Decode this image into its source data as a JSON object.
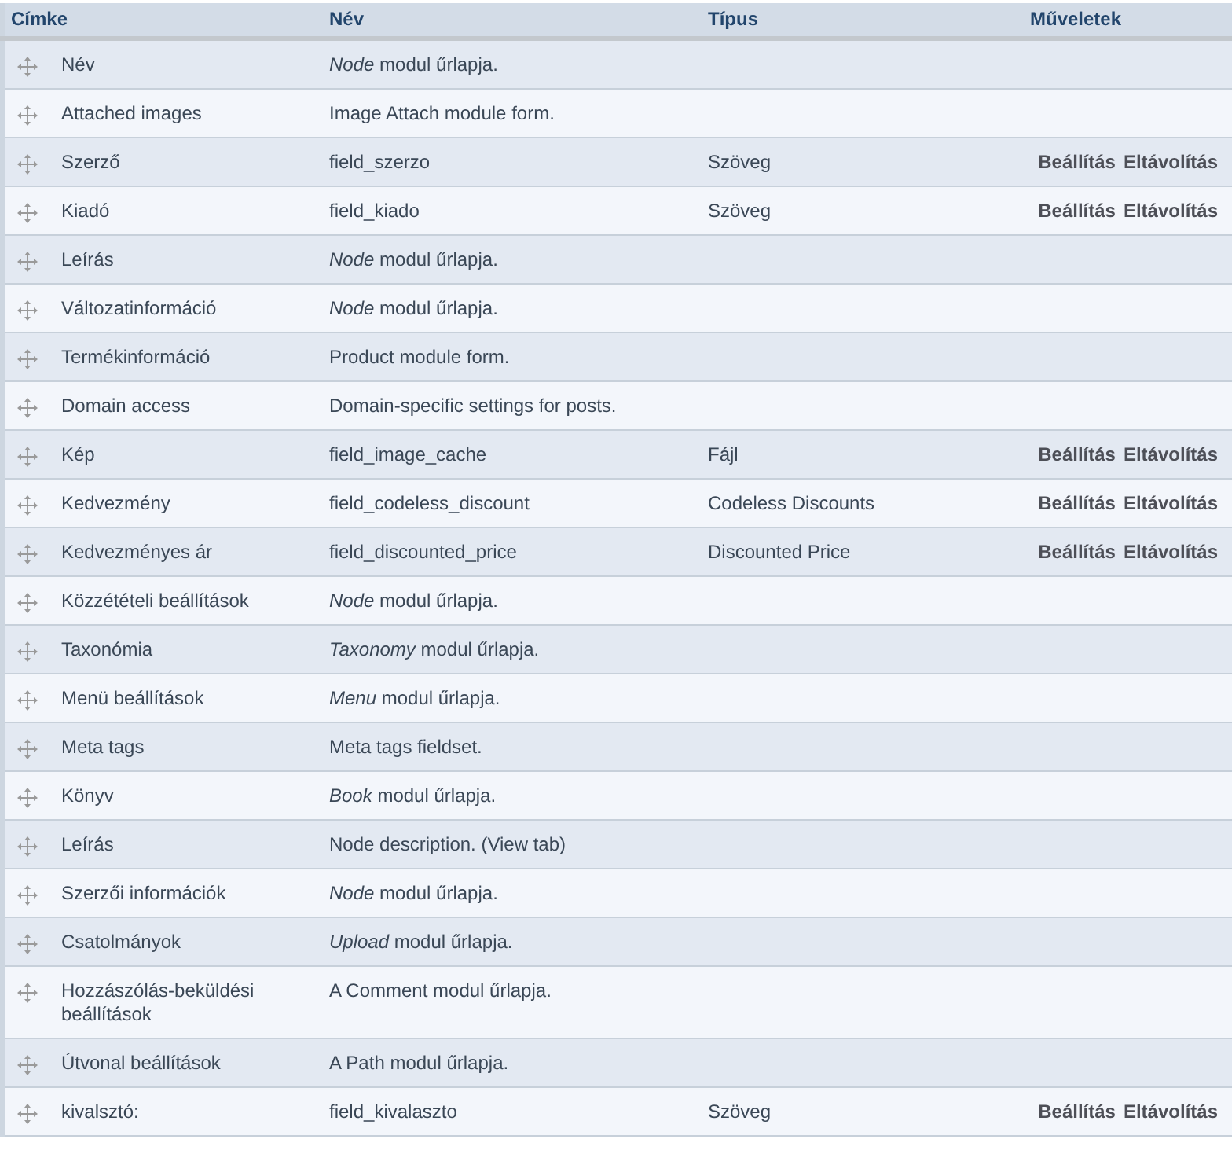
{
  "table": {
    "columns": [
      "Címke",
      "Név",
      "Típus",
      "Műveletek"
    ],
    "rows": [
      {
        "label": "Név",
        "name": "*Node* modul űrlapja."
      },
      {
        "label": "Attached images",
        "name": "Image Attach module form."
      },
      {
        "label": "Szerző",
        "name": "field_szerzo",
        "type": "Szöveg",
        "actions": [
          "Beállítás",
          "Eltávolítás"
        ]
      },
      {
        "label": "Kiadó",
        "name": "field_kiado",
        "type": "Szöveg",
        "actions": [
          "Beállítás",
          "Eltávolítás"
        ]
      },
      {
        "label": "Leírás",
        "name": "*Node* modul űrlapja."
      },
      {
        "label": "Változatinformáció",
        "name": "*Node* modul űrlapja."
      },
      {
        "label": "Termékinformáció",
        "name": "Product module form."
      },
      {
        "label": "Domain access",
        "name": "Domain-specific settings for posts."
      },
      {
        "label": "Kép",
        "name": "field_image_cache",
        "type": "Fájl",
        "actions": [
          "Beállítás",
          "Eltávolítás"
        ]
      },
      {
        "label": "Kedvezmény",
        "name": "field_codeless_discount",
        "type": "Codeless Discounts",
        "actions": [
          "Beállítás",
          "Eltávolítás"
        ]
      },
      {
        "label": "Kedvezményes ár",
        "name": "field_discounted_price",
        "type": "Discounted Price",
        "actions": [
          "Beállítás",
          "Eltávolítás"
        ]
      },
      {
        "label": "Közzétételi beállítások",
        "name": "*Node* modul űrlapja."
      },
      {
        "label": "Taxonómia",
        "name": "*Taxonomy* modul űrlapja."
      },
      {
        "label": "Menü beállítások",
        "name": "*Menu* modul űrlapja."
      },
      {
        "label": "Meta tags",
        "name": "Meta tags fieldset."
      },
      {
        "label": "Könyv",
        "name": "*Book* modul űrlapja."
      },
      {
        "label": "Leírás",
        "name": "Node description. (View tab)"
      },
      {
        "label": "Szerzői információk",
        "name": "*Node* modul űrlapja."
      },
      {
        "label": "Csatolmányok",
        "name": "*Upload* modul űrlapja."
      },
      {
        "label": "Hozzászólás-beküldési beállítások",
        "name": "A Comment modul űrlapja."
      },
      {
        "label": "Útvonal beállítások",
        "name": "A Path modul űrlapja."
      },
      {
        "label": "kivalsztó:",
        "name": "field_kivalaszto",
        "type": "Szöveg",
        "actions": [
          "Beállítás",
          "Eltávolítás"
        ]
      }
    ]
  }
}
